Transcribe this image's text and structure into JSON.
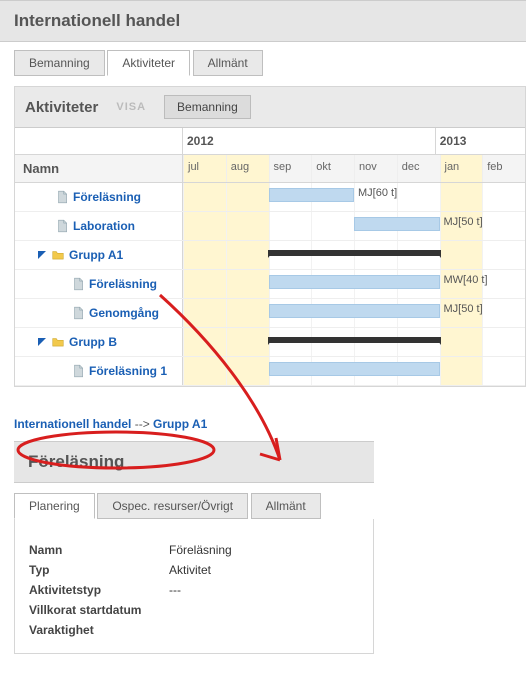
{
  "page_title": "Internationell handel",
  "top_tabs": {
    "bemanning": "Bemanning",
    "aktiviteter": "Aktiviteter",
    "allmant": "Allmänt",
    "active": "aktiviteter"
  },
  "activities": {
    "title": "Aktiviteter",
    "visa_label": "VISA",
    "bemanning_btn": "Bemanning",
    "years": {
      "y1": "2012",
      "y2": "2013"
    },
    "months": [
      "jul",
      "aug",
      "sep",
      "okt",
      "nov",
      "dec",
      "jan",
      "feb"
    ],
    "name_header": "Namn",
    "rows": [
      {
        "id": "forel1",
        "label": "Föreläsning",
        "icon": "page",
        "indent": 2,
        "type": "bar",
        "start": 2,
        "span": 2,
        "bar_label": "MJ[60 t]"
      },
      {
        "id": "lab",
        "label": "Laboration",
        "icon": "page",
        "indent": 2,
        "type": "bar",
        "start": 4,
        "span": 2,
        "bar_label": "MJ[50 t]"
      },
      {
        "id": "gruppA1",
        "label": "Grupp A1",
        "icon": "folder",
        "indent": 1,
        "type": "group",
        "start": 2,
        "span": 4,
        "expanded": true
      },
      {
        "id": "forel2",
        "label": "Föreläsning",
        "icon": "page",
        "indent": 3,
        "type": "bar",
        "start": 2,
        "span": 4,
        "bar_label": "MW[40 t]"
      },
      {
        "id": "genom",
        "label": "Genomgång",
        "icon": "page",
        "indent": 3,
        "type": "bar",
        "start": 2,
        "span": 4,
        "bar_label": "MJ[50 t]"
      },
      {
        "id": "gruppB",
        "label": "Grupp B",
        "icon": "folder",
        "indent": 1,
        "type": "group",
        "start": 2,
        "span": 4,
        "expanded": true
      },
      {
        "id": "forel3",
        "label": "Föreläsning 1",
        "icon": "page",
        "indent": 3,
        "type": "bar",
        "start": 2,
        "span": 4,
        "bar_label": ""
      }
    ]
  },
  "breadcrumb": {
    "items": [
      {
        "label": "Internationell handel",
        "link": true
      },
      {
        "label": "Grupp A1",
        "link": true
      }
    ],
    "sep": "-->"
  },
  "detail": {
    "title": "Föreläsning",
    "tabs": {
      "planering": "Planering",
      "ospec": "Ospec. resurser/Övrigt",
      "allmant": "Allmänt",
      "active": "planering"
    },
    "fields": [
      {
        "k": "Namn",
        "v": "Föreläsning"
      },
      {
        "k": "Typ",
        "v": "Aktivitet"
      },
      {
        "k": "Aktivitetstyp",
        "v": "---"
      },
      {
        "k": "Villkorat startdatum",
        "v": ""
      },
      {
        "k": "Varaktighet",
        "v": ""
      }
    ]
  },
  "colors": {
    "link": "#1a5fb4",
    "bar_fill": "#bfd9ef",
    "highlight": "#fff6d1",
    "annotation": "#d81e1e"
  }
}
